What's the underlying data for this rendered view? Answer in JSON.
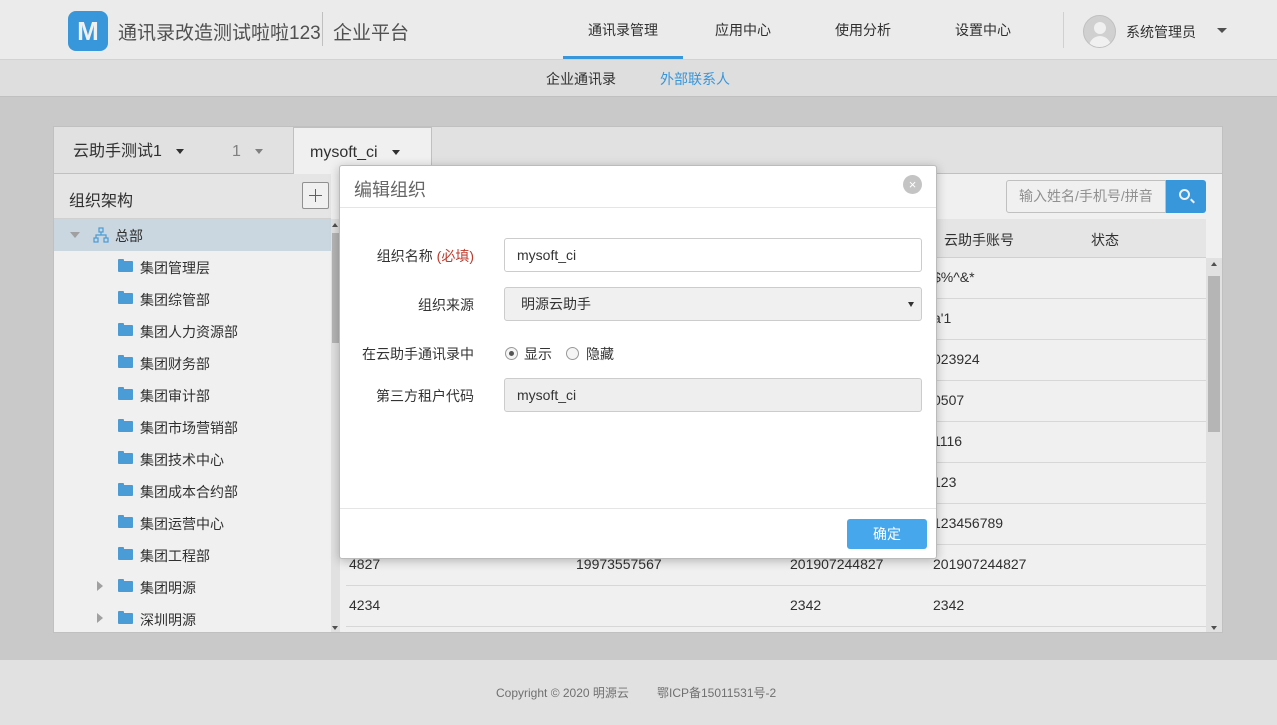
{
  "header": {
    "logo_letter": "M",
    "app_title": "通讯录改造测试啦啦123",
    "platform": "企业平台",
    "nav": [
      "通讯录管理",
      "应用中心",
      "使用分析",
      "设置中心"
    ],
    "user_name": "系统管理员",
    "accent_color": "#3ca0e8"
  },
  "subnav": [
    "企业通讯录",
    "外部联系人"
  ],
  "tabs": [
    {
      "label": "云助手测试1"
    },
    {
      "label": "1"
    },
    {
      "label": "mysoft_ci"
    }
  ],
  "org": {
    "title": "组织架构",
    "root": "总部",
    "items": [
      "集团管理层",
      "集团综管部",
      "集团人力资源部",
      "集团财务部",
      "集团审计部",
      "集团市场营销部",
      "集团技术中心",
      "集团成本合约部",
      "集团运营中心",
      "集团工程部",
      "集团明源",
      "深圳明源"
    ]
  },
  "search": {
    "placeholder": "输入姓名/手机号/拼音"
  },
  "table": {
    "headers": [
      "云助手账号",
      "状态"
    ],
    "rows": [
      {
        "c1": "",
        "c2": "",
        "c3": "",
        "c4": "$%^&*"
      },
      {
        "c1": "",
        "c2": "",
        "c3": "",
        "c4": "a'1"
      },
      {
        "c1": "",
        "c2": "",
        "c3": "",
        "c4": "023924"
      },
      {
        "c1": "",
        "c2": "",
        "c3": "",
        "c4": "0507"
      },
      {
        "c1": "",
        "c2": "",
        "c3": "",
        "c4": "1116"
      },
      {
        "c1": "",
        "c2": "",
        "c3": "",
        "c4": "123"
      },
      {
        "c1": "",
        "c2": "",
        "c3": "",
        "c4": "123456789"
      },
      {
        "c1": "4827",
        "c2": "19973557567",
        "c3": "201907244827",
        "c4": "201907244827"
      },
      {
        "c1": "4234",
        "c2": "",
        "c3": "2342",
        "c4": "2342"
      }
    ]
  },
  "modal": {
    "title": "编辑组织",
    "close_symbol": "×",
    "name_label": "组织名称",
    "required": "(必填)",
    "name_value": "mysoft_ci",
    "source_label": "组织来源",
    "source_value": "明源云助手",
    "visibility_label": "在云助手通讯录中",
    "show_label": "显示",
    "hide_label": "隐藏",
    "tenant_label": "第三方租户代码",
    "tenant_value": "mysoft_ci",
    "confirm": "确定"
  },
  "footer": {
    "copyright": "Copyright © 2020 明源云",
    "icp": "鄂ICP备15011531号-2"
  }
}
